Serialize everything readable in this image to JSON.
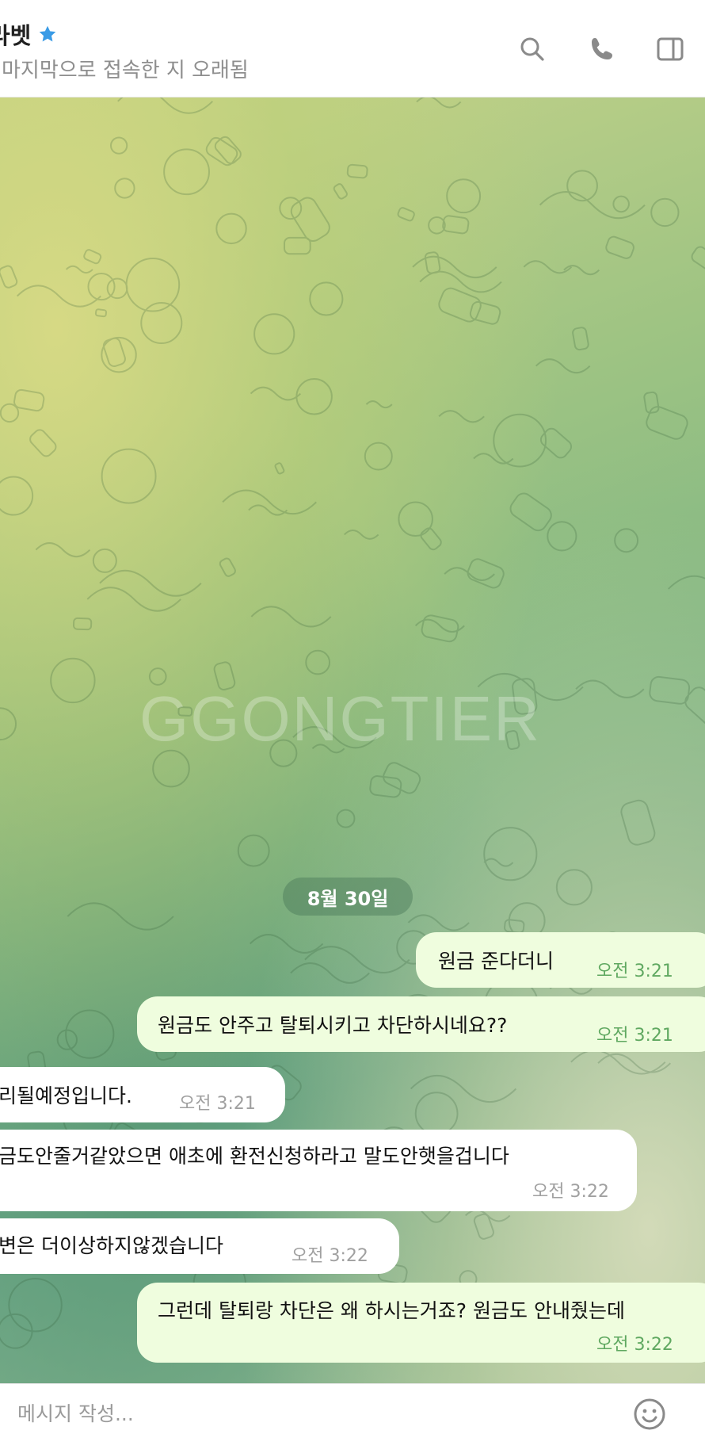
{
  "header": {
    "title": "라벳",
    "status": "마지막으로 접속한 지 오래됨",
    "icons": [
      "star-icon",
      "search-icon",
      "phone-icon",
      "sidebar-toggle-icon"
    ]
  },
  "chat": {
    "watermark": "GGONGTIER",
    "date": "8월 30일",
    "messages": [
      {
        "side": "out",
        "text": "원금 준다더니",
        "time": "오전 3:21"
      },
      {
        "side": "out",
        "text": "원금도 안주고 탈퇴시키고 차단하시네요??",
        "time": "오전 3:21"
      },
      {
        "side": "in",
        "text": "리될예정입니다.",
        "time": "오전 3:21"
      },
      {
        "side": "in",
        "text": "금도안줄거같았으면 애초에 환전신청하라고 말도안햇을겁니다",
        "time": "오전 3:22"
      },
      {
        "side": "in",
        "text": "변은 더이상하지않겠습니다",
        "time": "오전 3:22"
      },
      {
        "side": "out",
        "text": "그런데 탈퇴랑 차단은 왜 하시는거죠? 원금도 안내줬는데",
        "time": "오전 3:22"
      }
    ]
  },
  "composer": {
    "placeholder": "메시지 작성..."
  },
  "colors": {
    "outgoing_bubble": "#effdde",
    "incoming_bubble": "#ffffff",
    "outgoing_time": "#5fa860",
    "accent_star": "#3a9be6"
  }
}
